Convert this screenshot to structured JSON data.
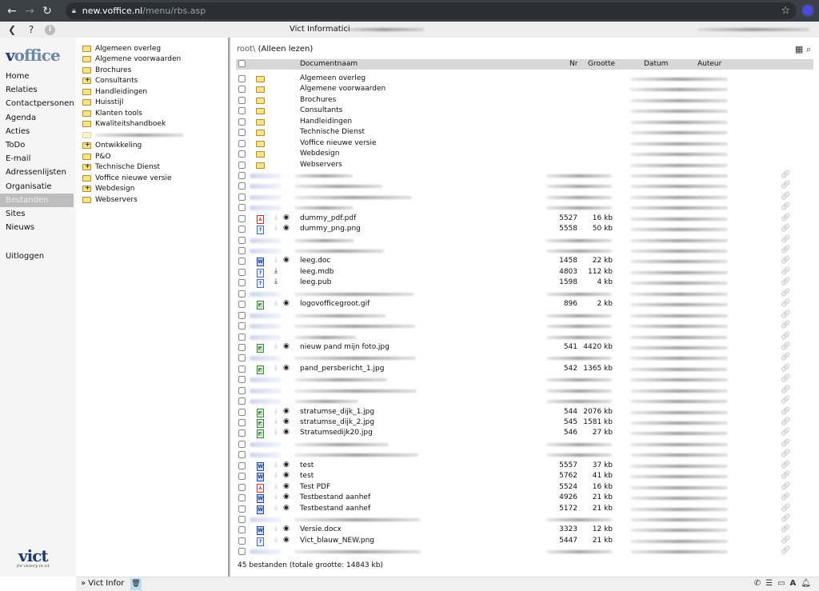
{
  "browser": {
    "url_host": "new.voffice.nl",
    "url_path": "/menu/rbs.asp"
  },
  "appbar": {
    "back": "❮",
    "help": "?",
    "info": "i",
    "org_name": "Vict Informatici"
  },
  "logo": {
    "part1": "v",
    "part2": "office"
  },
  "menu": [
    {
      "label": "Home"
    },
    {
      "label": "Relaties"
    },
    {
      "label": "Contactpersonen"
    },
    {
      "label": "Agenda"
    },
    {
      "label": "Acties"
    },
    {
      "label": "ToDo"
    },
    {
      "label": "E-mail"
    },
    {
      "label": "Adressenlijsten"
    },
    {
      "label": "Organisatie"
    },
    {
      "label": "Bestanden",
      "active": true
    },
    {
      "label": "Sites"
    },
    {
      "label": "Nieuws"
    }
  ],
  "logout": "Uitloggen",
  "vict_logo": {
    "name": "vict",
    "tagline": "for victory in ict"
  },
  "tree": [
    {
      "label": "Algemeen overleg",
      "plus": false
    },
    {
      "label": "Algemene voorwaarden",
      "plus": false
    },
    {
      "label": "Brochures",
      "plus": false
    },
    {
      "label": "Consultants",
      "plus": true
    },
    {
      "label": "Handleidingen",
      "plus": false
    },
    {
      "label": "Huisstijl",
      "plus": false
    },
    {
      "label": "Klanten tools",
      "plus": false
    },
    {
      "label": "Kwaliteitshandboek",
      "plus": false
    },
    {
      "label": "",
      "plus": false,
      "blurred": true
    },
    {
      "label": "Ontwikkeling",
      "plus": true
    },
    {
      "label": "P&O",
      "plus": false
    },
    {
      "label": "Technische Dienst",
      "plus": true
    },
    {
      "label": "Voffice nieuwe versie",
      "plus": false
    },
    {
      "label": "Webdesign",
      "plus": true
    },
    {
      "label": "Webservers",
      "plus": false
    }
  ],
  "main": {
    "crumb_root": "root\\",
    "crumb_mode": " (Alleen lezen)",
    "columns": {
      "name": "Documentnaam",
      "nr": "Nr",
      "size": "Grootte",
      "date": "Datum",
      "author": "Auteur"
    },
    "rows": [
      {
        "type": "folder",
        "name": "Algemeen overleg"
      },
      {
        "type": "folder",
        "name": "Algemene voorwaarden"
      },
      {
        "type": "folder",
        "name": "Brochures"
      },
      {
        "type": "folder",
        "name": "Consultants"
      },
      {
        "type": "folder",
        "name": "Handleidingen"
      },
      {
        "type": "folder",
        "name": "Technische Dienst"
      },
      {
        "type": "folder",
        "name": "Voffice nieuwe versie"
      },
      {
        "type": "folder",
        "name": "Webdesign"
      },
      {
        "type": "folder",
        "name": "Webservers"
      },
      {
        "type": "blurred"
      },
      {
        "type": "blurred"
      },
      {
        "type": "blurred"
      },
      {
        "type": "blurred"
      },
      {
        "type": "file",
        "icon": "pdf",
        "name": "dummy_pdf.pdf",
        "nr": "5527",
        "size": "16 kb",
        "eye": true
      },
      {
        "type": "file",
        "icon": "unk",
        "name": "dummy_png.png",
        "nr": "5558",
        "size": "50 kb",
        "eye": true
      },
      {
        "type": "blurred"
      },
      {
        "type": "blurred"
      },
      {
        "type": "file",
        "icon": "doc",
        "name": "leeg.doc",
        "nr": "1458",
        "size": "22 kb",
        "eye": true
      },
      {
        "type": "file",
        "icon": "unk",
        "name": "leeg.mdb",
        "nr": "4803",
        "size": "112 kb",
        "eye": false
      },
      {
        "type": "file",
        "icon": "unk",
        "name": "leeg.pub",
        "nr": "1598",
        "size": "4 kb",
        "eye": false
      },
      {
        "type": "blurred"
      },
      {
        "type": "file",
        "icon": "img",
        "name": "logovofficegroot.gif",
        "nr": "896",
        "size": "2 kb",
        "eye": true
      },
      {
        "type": "blurred"
      },
      {
        "type": "blurred"
      },
      {
        "type": "blurred"
      },
      {
        "type": "file",
        "icon": "img",
        "name": "nieuw pand mijn foto.jpg",
        "nr": "541",
        "size": "4420 kb",
        "eye": true
      },
      {
        "type": "blurred"
      },
      {
        "type": "file",
        "icon": "img",
        "name": "pand_persbericht_1.jpg",
        "nr": "542",
        "size": "1365 kb",
        "eye": true
      },
      {
        "type": "blurred"
      },
      {
        "type": "blurred"
      },
      {
        "type": "blurred"
      },
      {
        "type": "file",
        "icon": "img",
        "name": "stratumse_dijk_1.jpg",
        "nr": "544",
        "size": "2076 kb",
        "eye": true
      },
      {
        "type": "file",
        "icon": "img",
        "name": "stratumse_dijk_2.jpg",
        "nr": "545",
        "size": "1581 kb",
        "eye": true
      },
      {
        "type": "file",
        "icon": "img",
        "name": "Stratumsedijk20.jpg",
        "nr": "546",
        "size": "27 kb",
        "eye": true
      },
      {
        "type": "blurred"
      },
      {
        "type": "blurred"
      },
      {
        "type": "file",
        "icon": "doc",
        "name": "test",
        "nr": "5557",
        "size": "37 kb",
        "eye": true
      },
      {
        "type": "file",
        "icon": "doc",
        "name": "test",
        "nr": "5762",
        "size": "41 kb",
        "eye": true
      },
      {
        "type": "file",
        "icon": "pdf",
        "name": "Test PDF",
        "nr": "5524",
        "size": "16 kb",
        "eye": true
      },
      {
        "type": "file",
        "icon": "doc",
        "name": "Testbestand aanhef",
        "nr": "4926",
        "size": "21 kb",
        "eye": true
      },
      {
        "type": "file",
        "icon": "doc",
        "name": "Testbestand aanhef",
        "nr": "5172",
        "size": "21 kb",
        "eye": true
      },
      {
        "type": "blurred"
      },
      {
        "type": "file",
        "icon": "doc",
        "name": "Versie.docx",
        "nr": "3323",
        "size": "12 kb",
        "eye": true
      },
      {
        "type": "file",
        "icon": "unk",
        "name": "Vict_blauw_NEW.png",
        "nr": "5447",
        "size": "21 kb",
        "eye": true
      },
      {
        "type": "blurred"
      }
    ],
    "total": "45 bestanden (totale grootte: 14843 kb)"
  },
  "bottombar": {
    "tab_label": "» Vict Infor"
  }
}
